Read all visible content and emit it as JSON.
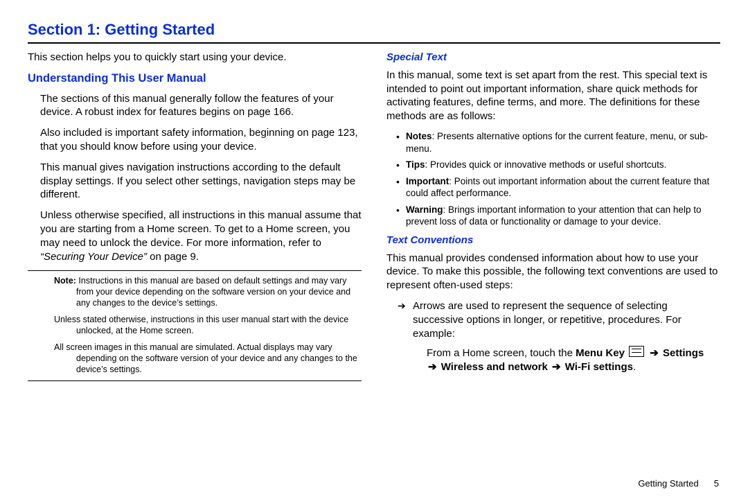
{
  "header": {
    "title": "Section 1: Getting Started"
  },
  "left": {
    "intro": "This section helps you to quickly start using your device.",
    "subheading": "Understanding This User Manual",
    "p1": "The sections of this manual generally follow the features of your device. A robust index for features begins on page 166.",
    "p2": "Also included is important safety information, beginning on page 123, that you should know before using your device.",
    "p3": "This manual gives navigation instructions according to the default display settings. If you select other settings, navigation steps may be different.",
    "p4_pre": "Unless otherwise specified, all instructions in this manual assume that you are starting from a Home screen. To get to a Home screen, you may need to unlock the device. For more information, refer to ",
    "p4_ref": "“Securing Your Device”",
    "p4_post": "  on page 9.",
    "note_label": "Note:",
    "note1_post": " Instructions in this manual are based on default settings and may vary from your device depending on the software version on your device and any changes to the device’s settings.",
    "note2": "Unless stated otherwise, instructions in this user manual start with the device unlocked, at the Home screen.",
    "note3": "All screen images in this manual are simulated. Actual displays may vary depending on the software version of your device and any changes to the device’s settings."
  },
  "right": {
    "special_heading": "Special Text",
    "special_intro": "In this manual, some text is set apart from the rest. This special text is intended to point out important information, share quick methods for activating features, define terms, and more. The definitions for these methods are as follows:",
    "bullets": [
      {
        "label": "Notes",
        "text": ": Presents alternative options for the current feature, menu, or sub-menu."
      },
      {
        "label": "Tips",
        "text": ": Provides quick or innovative methods or useful shortcuts."
      },
      {
        "label": "Important",
        "text": ": Points out important information about the current feature that could affect performance."
      },
      {
        "label": "Warning",
        "text": ": Brings important information to your attention that can help to prevent loss of data or functionality or damage to your device."
      }
    ],
    "textconv_heading": "Text Conventions",
    "textconv_intro": "This manual provides condensed information about how to use your device. To make this possible, the following text conventions are used to represent often-used steps:",
    "arrow_item": "Arrows are used to represent the sequence of selecting successive options in longer, or repetitive, procedures. For example:",
    "menu_pre": "From a Home screen, touch the ",
    "menu_key": "Menu Key",
    "menu_settings": "Settings",
    "menu_wireless": "Wireless and network",
    "menu_wifi": "Wi-Fi settings",
    "arrow_glyph": "➔"
  },
  "footer": {
    "label": "Getting Started",
    "page": "5"
  }
}
